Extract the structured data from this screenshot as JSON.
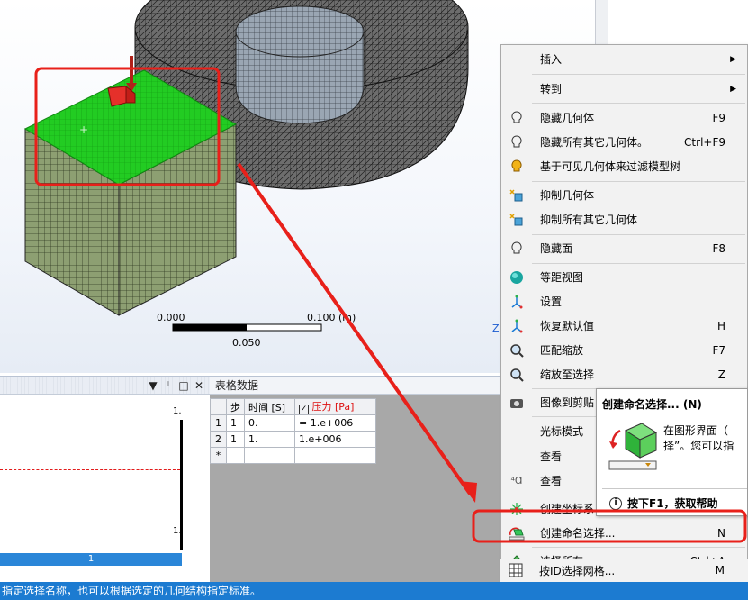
{
  "viewport": {
    "scale": {
      "left": "0.000",
      "right": "0.100",
      "unit": "(m)",
      "mid": "0.050"
    },
    "axis_letter": "Z"
  },
  "graph_panel": {
    "buttons": [
      "▼",
      "ᛌ",
      "□",
      "✕"
    ],
    "top_label": "1.",
    "bottom_label": "1.",
    "bar_label": "1"
  },
  "table_panel": {
    "title": "表格数据",
    "columns": [
      "步",
      "时间 [S]",
      "压力 [Pa]"
    ],
    "pressure_checked": true,
    "rows": [
      {
        "row": "1",
        "step": "1",
        "time": "0.",
        "pressure": "= 1.e+006"
      },
      {
        "row": "2",
        "step": "1",
        "time": "1.",
        "pressure": "1.e+006"
      }
    ],
    "new_row_marker": "*"
  },
  "context_menu": {
    "items": [
      {
        "label": "插入",
        "shortcut": "",
        "submenu": true,
        "icon": ""
      },
      {
        "label": "转到",
        "shortcut": "",
        "submenu": true,
        "icon": ""
      },
      {
        "label": "隐藏几何体",
        "shortcut": "F9",
        "icon": "bulb-off-icon"
      },
      {
        "label": "隐藏所有其它几何体。",
        "shortcut": "Ctrl+F9",
        "icon": "bulb-off-icon"
      },
      {
        "label": "基于可见几何体来过滤模型树",
        "shortcut": "",
        "icon": "bulb-on-icon"
      },
      {
        "label": "抑制几何体",
        "shortcut": "",
        "icon": "suppress-icon"
      },
      {
        "label": "抑制所有其它几何体",
        "shortcut": "",
        "icon": "suppress-icon"
      },
      {
        "label": "隐藏面",
        "shortcut": "F8",
        "icon": "bulb-off-icon"
      },
      {
        "label": "等距视图",
        "shortcut": "",
        "icon": "sphere-icon"
      },
      {
        "label": "设置",
        "shortcut": "",
        "icon": "axes-icon"
      },
      {
        "label": "恢复默认值",
        "shortcut": "H",
        "icon": "axes-icon"
      },
      {
        "label": "匹配缩放",
        "shortcut": "F7",
        "icon": "zoom-fit-icon"
      },
      {
        "label": "缩放至选择",
        "shortcut": "Z",
        "icon": "zoom-fit-icon"
      },
      {
        "label": "图像到剪贴",
        "shortcut": "",
        "icon": "camera-icon"
      },
      {
        "label": "光标模式",
        "shortcut": "",
        "icon": ""
      },
      {
        "label": "查看",
        "shortcut": "",
        "icon": ""
      },
      {
        "label": "查看",
        "shortcut": "",
        "icon": "cursor-icon"
      },
      {
        "label": "创建坐标系",
        "shortcut": "",
        "icon": "coordinate-icon"
      },
      {
        "label": "创建命名选择...",
        "shortcut": "N",
        "icon": "named-selection-icon"
      },
      {
        "label": "选择所有",
        "shortcut": "Ctrl+A",
        "icon": "select-all-icon"
      },
      {
        "label": "按ID选择网格...",
        "shortcut": "M",
        "icon": "grid-icon"
      }
    ]
  },
  "tooltip": {
    "title": "创建命名选择... (N)",
    "line1": "在图形界面（",
    "line2": "择”。您可以指",
    "help": "按下F1，获取帮助"
  },
  "status_bar": {
    "text": "指定选择名称，也可以根据选定的几何结构指定标准。"
  },
  "colors": {
    "accent_red": "#e8201a",
    "face_green": "#22cc22",
    "mesh_green": "#8a9c70",
    "status_blue": "#1c7bd1"
  }
}
